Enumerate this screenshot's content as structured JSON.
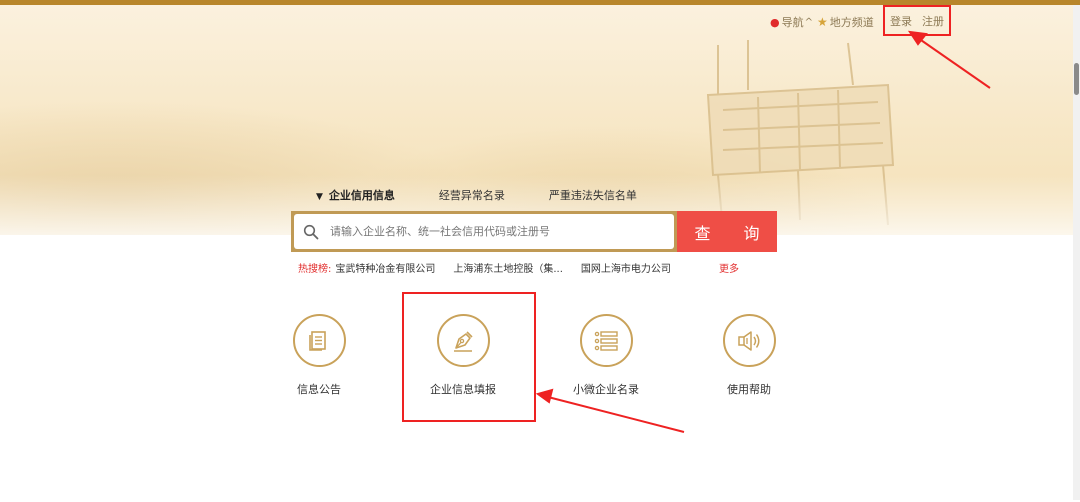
{
  "topnav": {
    "nav_label": "导航",
    "nav_chevron": "^",
    "channel_label": "地方频道",
    "login_label": "登录",
    "register_label": "注册"
  },
  "tabs": [
    {
      "label": "企业信用信息",
      "active": true
    },
    {
      "label": "经营异常名录",
      "active": false
    },
    {
      "label": "严重违法失信名单",
      "active": false
    }
  ],
  "search": {
    "placeholder": "请输入企业名称、统一社会信用代码或注册号",
    "button_label": "查 询"
  },
  "hot": {
    "label": "热搜榜:",
    "keywords": [
      "宝武特种冶金有限公司",
      "上海浦东土地控股（集...",
      "国网上海市电力公司"
    ],
    "more_label": "更多"
  },
  "services": [
    {
      "label": "信息公告",
      "icon": "document-icon"
    },
    {
      "label": "企业信息填报",
      "icon": "pen-icon"
    },
    {
      "label": "小微企业名录",
      "icon": "list-icon"
    },
    {
      "label": "使用帮助",
      "icon": "speaker-icon"
    }
  ],
  "colors": {
    "accent_gold": "#c9a25a",
    "search_button": "#ef4e46",
    "annotation_red": "#ee2222"
  }
}
